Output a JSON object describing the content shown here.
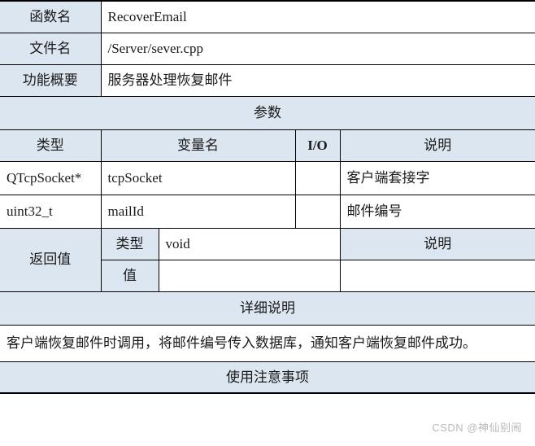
{
  "table": {
    "info_rows": [
      {
        "label": "函数名",
        "value": "RecoverEmail"
      },
      {
        "label": "文件名",
        "value": "/Server/sever.cpp"
      },
      {
        "label": "功能概要",
        "value": "服务器处理恢复邮件"
      }
    ],
    "params_section": {
      "title": "参数",
      "columns": [
        "类型",
        "变量名",
        "I/O",
        "说明"
      ],
      "rows": [
        {
          "type": "QTcpSocket*",
          "name": "tcpSocket",
          "io": "",
          "desc": "客户端套接字"
        },
        {
          "type": "uint32_t",
          "name": "mailId",
          "io": "",
          "desc": "邮件编号"
        }
      ]
    },
    "return_section": {
      "label": "返回值",
      "type_label": "类型",
      "type_value": "void",
      "desc_label": "说明",
      "desc_value": "",
      "value_label": "值",
      "value_value": "",
      "value_desc": ""
    },
    "detail_section": {
      "title": "详细说明",
      "body": "客户端恢复邮件时调用，将邮件编号传入数据库，通知客户端恢复邮件成功。"
    },
    "notes_section": {
      "title": "使用注意事项",
      "body": ""
    }
  },
  "watermark": {
    "text": "CSDN @神仙别闹"
  },
  "colors": {
    "header_bg": "#dce6f1",
    "cell_bg": "#ffffff",
    "border": "#000000",
    "text": "#1a1a1a",
    "watermark": "#b9b9b9"
  }
}
